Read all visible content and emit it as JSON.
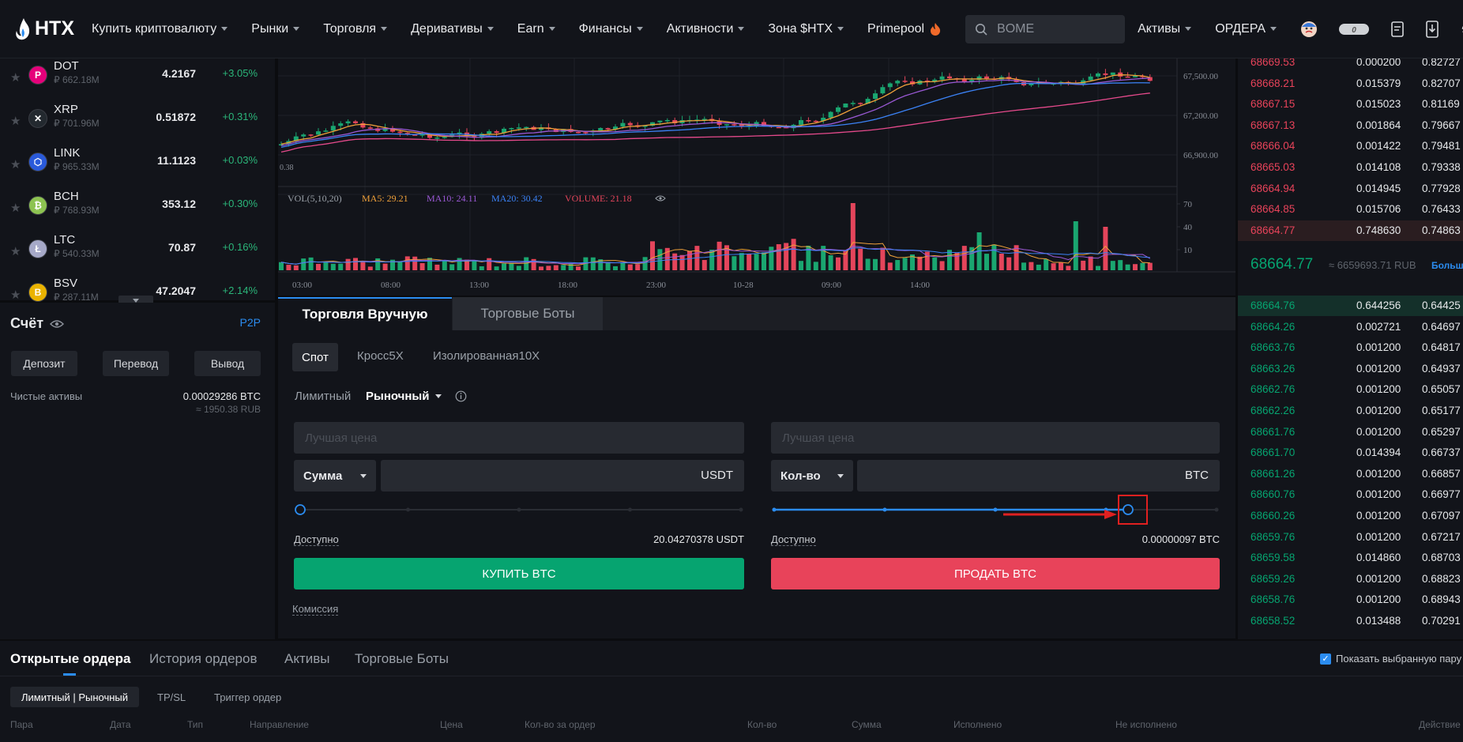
{
  "header": {
    "logo": "HTX",
    "nav": [
      {
        "label": "Купить криптовалюту",
        "caret": true
      },
      {
        "label": "Рынки",
        "caret": true
      },
      {
        "label": "Торговля",
        "caret": true
      },
      {
        "label": "Деривативы",
        "caret": true
      },
      {
        "label": "Earn",
        "caret": true
      },
      {
        "label": "Финансы",
        "caret": true
      },
      {
        "label": "Активности",
        "caret": true
      },
      {
        "label": "Зона $HTX",
        "caret": true
      },
      {
        "label": "Primepool",
        "caret": false,
        "icon": "fire-icon"
      }
    ],
    "search_placeholder": "BOME",
    "right_nav": [
      {
        "label": "Активы",
        "caret": true
      },
      {
        "label": "ОРДЕРА",
        "caret": true
      }
    ]
  },
  "markets": [
    {
      "symbol": "DOT",
      "cap": "₽ 662.18M",
      "price": "4.2167",
      "change": "+3.05%",
      "color": "#e6007a",
      "glyph": "P"
    },
    {
      "symbol": "XRP",
      "cap": "₽ 701.96M",
      "price": "0.51872",
      "change": "+0.31%",
      "color": "#23292f",
      "glyph": "✕"
    },
    {
      "symbol": "LINK",
      "cap": "₽ 965.33M",
      "price": "11.1123",
      "change": "+0.03%",
      "color": "#2a5ada",
      "glyph": "⬡"
    },
    {
      "symbol": "BCH",
      "cap": "₽ 768.93M",
      "price": "353.12",
      "change": "+0.30%",
      "color": "#8dc351",
      "glyph": "₿"
    },
    {
      "symbol": "LTC",
      "cap": "₽ 540.33M",
      "price": "70.87",
      "change": "+0.16%",
      "color": "#a6a9c8",
      "glyph": "Ł"
    },
    {
      "symbol": "BSV",
      "cap": "₽ 287.11M",
      "price": "47.2047",
      "change": "+2.14%",
      "color": "#eab300",
      "glyph": "B"
    }
  ],
  "account": {
    "title": "Счёт",
    "p2p": "P2P",
    "buttons": [
      "Депозит",
      "Перевод",
      "Вывод"
    ],
    "net_label": "Чистые активы",
    "net_btc": "0.00029286 BTC",
    "net_rub": "≈ 1950.38 RUB"
  },
  "chart": {
    "price_ticks": [
      "67,500.00",
      "67,200.00",
      "66,900.00"
    ],
    "left_value": "0.38",
    "vol_legend": {
      "vol": "VOL(5,10,20)",
      "ma5": "MA5: 29.21",
      "ma10": "MA10: 24.11",
      "ma20": "MA20: 30.42",
      "volume": "VOLUME: 21.18"
    },
    "vol_ticks": [
      "70",
      "40",
      "10"
    ],
    "time_ticks": [
      "03:00",
      "08:00",
      "13:00",
      "18:00",
      "23:00",
      "10-28",
      "09:00",
      "14:00"
    ],
    "colors": {
      "up": "#1aa670",
      "down": "#e4455b",
      "ma5": "#f0a13a",
      "ma10": "#9b59d6",
      "ma20": "#3b82f6",
      "ma_long": "#e64a8c"
    }
  },
  "trade": {
    "tabs": [
      "Торговля Вручную",
      "Торговые Боты"
    ],
    "subtabs": [
      "Спот",
      "Кросс5X",
      "Изолированная10X"
    ],
    "order_types": {
      "limit": "Лимитный",
      "market": "Рыночный"
    },
    "buy": {
      "price_placeholder": "Лучшая цена",
      "select": "Сумма",
      "unit": "USDT",
      "slider_level": 0,
      "available_label": "Доступно",
      "available_value": "20.04270378 USDT",
      "button": "КУПИТЬ BTC"
    },
    "sell": {
      "price_placeholder": "Лучшая цена",
      "select": "Кол-во",
      "unit": "BTC",
      "slider_level": 0.8,
      "available_label": "Доступно",
      "available_value": "0.00000097 BTC",
      "button": "ПРОДАТЬ BTC"
    },
    "fee_label": "Комиссия",
    "colors": {
      "buy": "#06a470",
      "sell": "#e8435a",
      "accent": "#2b8cf0",
      "highlight": "#e02020"
    }
  },
  "orderbook": {
    "asks": [
      [
        "68669.53",
        "0.000200",
        "0.82727"
      ],
      [
        "68668.21",
        "0.015379",
        "0.82707"
      ],
      [
        "68667.15",
        "0.015023",
        "0.81169"
      ],
      [
        "68667.13",
        "0.001864",
        "0.79667"
      ],
      [
        "68666.04",
        "0.001422",
        "0.79481"
      ],
      [
        "68665.03",
        "0.014108",
        "0.79338"
      ],
      [
        "68664.94",
        "0.014945",
        "0.77928"
      ],
      [
        "68664.85",
        "0.015706",
        "0.76433"
      ],
      [
        "68664.77",
        "0.748630",
        "0.74863"
      ]
    ],
    "mid_price": "68664.77",
    "mid_rub": "≈ 6659693.71 RUB",
    "more": "Больш",
    "bids": [
      [
        "68664.76",
        "0.644256",
        "0.64425"
      ],
      [
        "68664.26",
        "0.002721",
        "0.64697"
      ],
      [
        "68663.76",
        "0.001200",
        "0.64817"
      ],
      [
        "68663.26",
        "0.001200",
        "0.64937"
      ],
      [
        "68662.76",
        "0.001200",
        "0.65057"
      ],
      [
        "68662.26",
        "0.001200",
        "0.65177"
      ],
      [
        "68661.76",
        "0.001200",
        "0.65297"
      ],
      [
        "68661.70",
        "0.014394",
        "0.66737"
      ],
      [
        "68661.26",
        "0.001200",
        "0.66857"
      ],
      [
        "68660.76",
        "0.001200",
        "0.66977"
      ],
      [
        "68660.26",
        "0.001200",
        "0.67097"
      ],
      [
        "68659.76",
        "0.001200",
        "0.67217"
      ],
      [
        "68659.58",
        "0.014860",
        "0.68703"
      ],
      [
        "68659.26",
        "0.001200",
        "0.68823"
      ],
      [
        "68658.76",
        "0.001200",
        "0.68943"
      ],
      [
        "68658.52",
        "0.013488",
        "0.70291"
      ]
    ]
  },
  "bottom": {
    "tabs": [
      "Открытые ордера",
      "История ордеров",
      "Активы",
      "Торговые Боты"
    ],
    "show_pair": "Показать выбранную пару",
    "subtabs": [
      "Лимитный | Рыночный",
      "TP/SL",
      "Триггер ордер"
    ],
    "columns": [
      "Пара",
      "Дата",
      "Тип",
      "Направление",
      "Цена",
      "Кол-во за ордер",
      "Кол-во",
      "Сумма",
      "Исполнено",
      "Не исполнено",
      "Действие"
    ]
  }
}
